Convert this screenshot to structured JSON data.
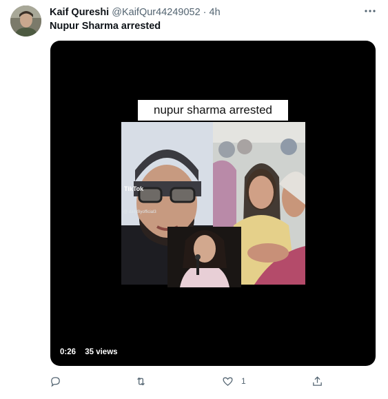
{
  "tweet": {
    "author_name": "Kaif Qureshi",
    "author_handle": "@KaifQur44249052",
    "separator": "·",
    "time": "4h",
    "text": "Nupur Sharma arrested"
  },
  "media": {
    "caption": "nupur sharma arrested",
    "overlay_brand": "TikTok",
    "overlay_user": "@ dailyfilyofficial3",
    "duration": "0:26",
    "views": "35 views"
  },
  "actions": {
    "reply_icon": "reply-icon",
    "retweet_icon": "retweet-icon",
    "like_icon": "heart-icon",
    "like_count": "1",
    "share_icon": "share-icon"
  },
  "colors": {
    "text_primary": "#0f1419",
    "text_secondary": "#536471",
    "media_bg": "#000000"
  }
}
